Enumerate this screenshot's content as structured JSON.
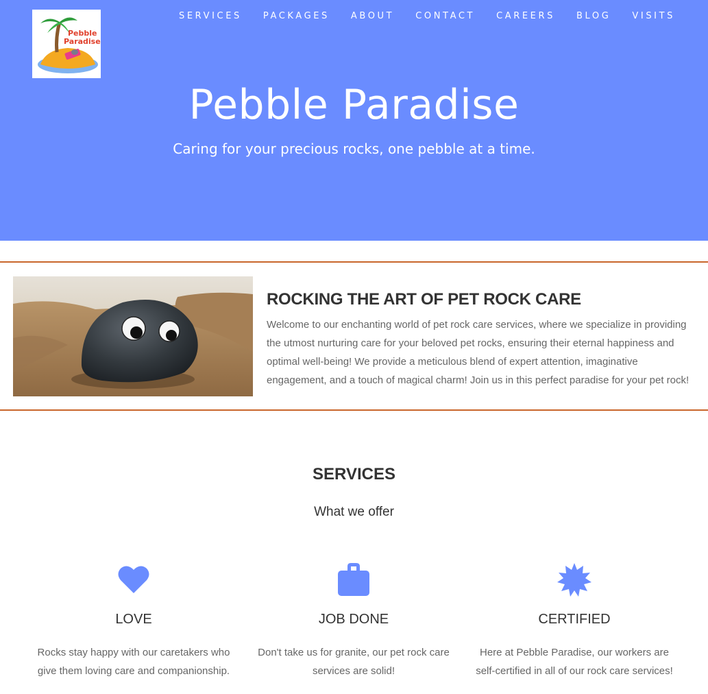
{
  "brand": {
    "logo_text_line1": "Pebble",
    "logo_text_line2": "Paradise"
  },
  "nav": {
    "items": [
      "SERVICES",
      "PACKAGES",
      "ABOUT",
      "CONTACT",
      "CAREERS",
      "BLOG",
      "VISITS"
    ]
  },
  "hero": {
    "title": "Pebble Paradise",
    "subtitle": "Caring for your precious rocks, one pebble at a time."
  },
  "about": {
    "heading": "ROCKING THE ART OF PET ROCK CARE",
    "text": "Welcome to our enchanting world of pet rock care services, where we specialize in providing the utmost nurturing care for your beloved pet rocks, ensuring their eternal happiness and optimal well-being! We provide a meticulous blend of expert attention, imaginative engagement, and a touch of magical charm! Join us in this perfect paradise for your pet rock!"
  },
  "services": {
    "title": "SERVICES",
    "subtitle": "What we offer",
    "items": [
      {
        "icon": "heart-icon",
        "title": "LOVE",
        "text": "Rocks stay happy with our caretakers who give them loving care and companionship."
      },
      {
        "icon": "briefcase-icon",
        "title": "JOB DONE",
        "text": "Don't take us for granite, our pet rock care services are solid!"
      },
      {
        "icon": "certificate-icon",
        "title": "CERTIFIED",
        "text": "Here at Pebble Paradise, our workers are self-certified in all of our rock care services!"
      }
    ]
  },
  "colors": {
    "hero_bg": "#6a8cff",
    "accent": "#6a8cff",
    "rule": "#c9662b"
  }
}
